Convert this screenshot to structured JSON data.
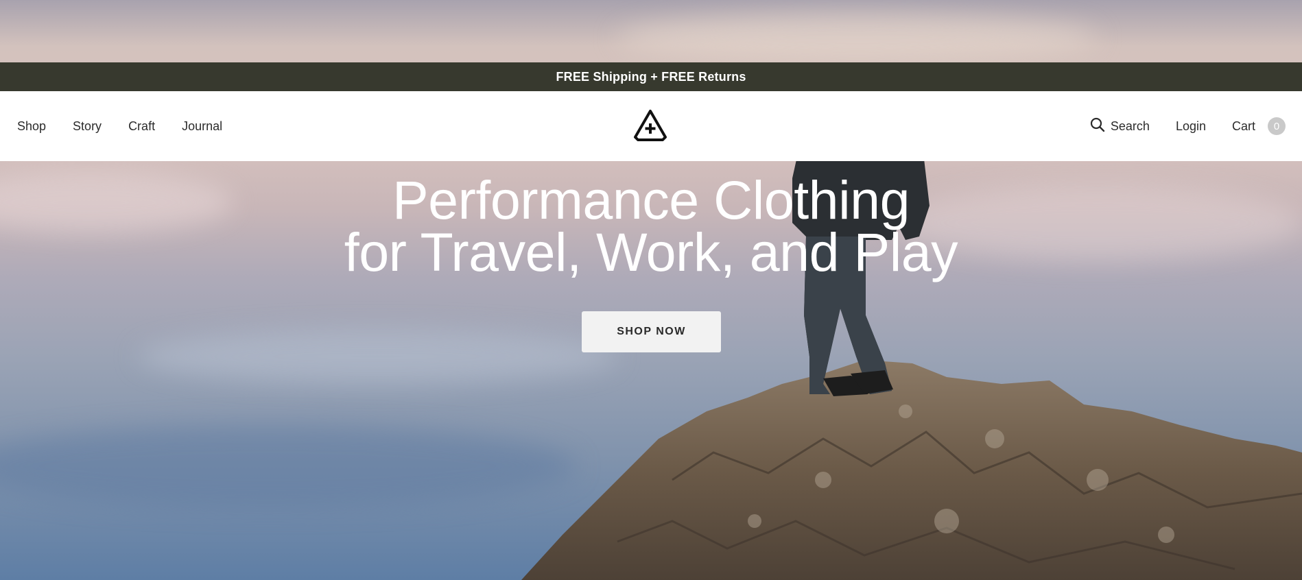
{
  "announcement": {
    "text": "FREE Shipping + FREE Returns"
  },
  "header": {
    "nav": [
      {
        "label": "Shop"
      },
      {
        "label": "Story"
      },
      {
        "label": "Craft"
      },
      {
        "label": "Journal"
      }
    ],
    "logo_icon": "triangle-plus-logo-icon",
    "search_label": "Search",
    "search_icon": "search-icon",
    "login_label": "Login",
    "cart_label": "Cart",
    "cart_count": "0"
  },
  "hero": {
    "title_line1": "Performance Clothing",
    "title_line2": "for Travel, Work, and Play",
    "cta_label": "SHOP NOW"
  },
  "colors": {
    "announcement_bg": "#37392e",
    "header_bg": "#ffffff",
    "cta_bg": "#f2f2f2"
  }
}
